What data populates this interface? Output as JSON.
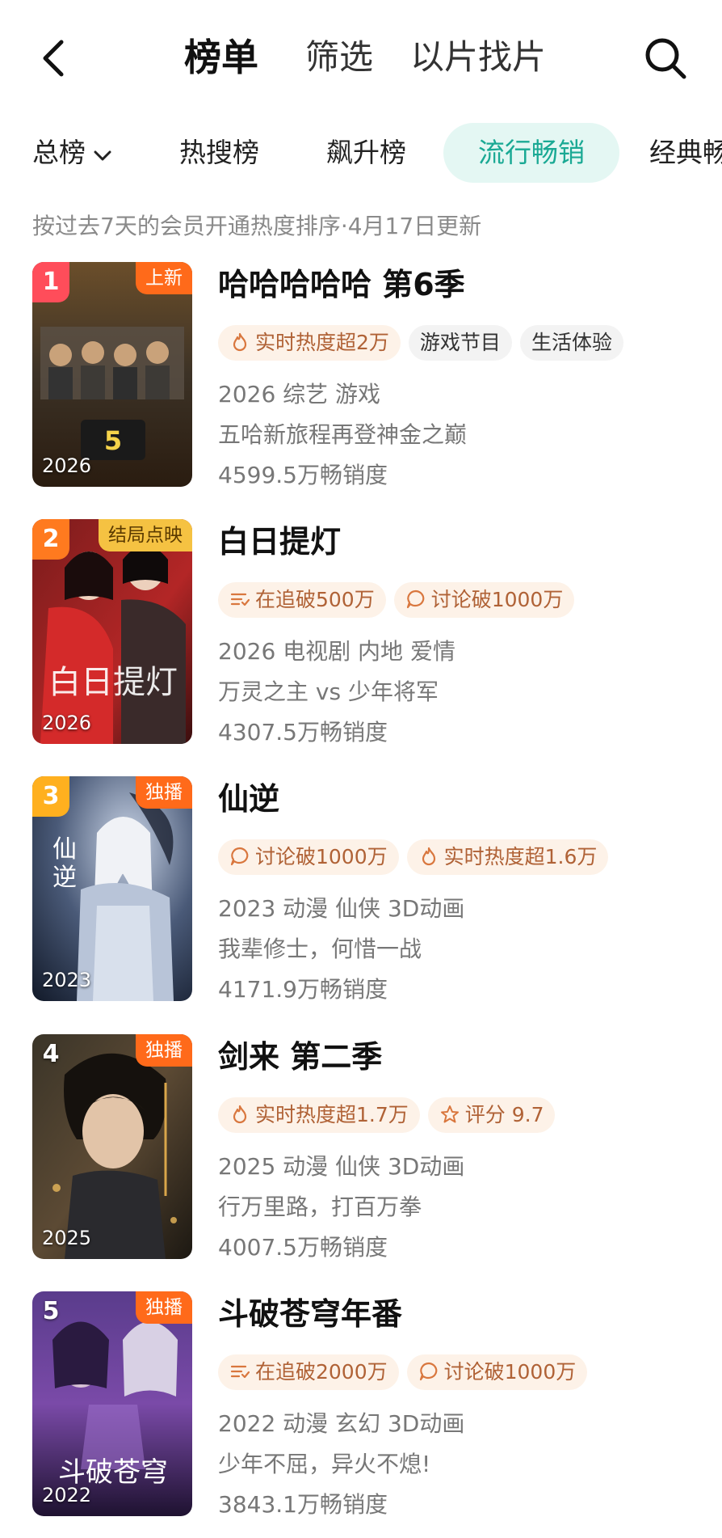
{
  "header": {
    "title": "榜单",
    "filter_label": "筛选",
    "photo_search_label": "以片找片"
  },
  "tabs": {
    "total": "总榜",
    "hot_search": "热搜榜",
    "rising": "飙升榜",
    "popular": "流行畅销",
    "classic": "经典畅"
  },
  "subtitle": "按过去7天的会员开通热度排序·4月17日更新",
  "items": [
    {
      "rank": "1",
      "corner_tag": "上新",
      "year_label": "2026",
      "title": "哈哈哈哈哈 第6季",
      "chips": [
        {
          "icon": "flame-icon",
          "text": "实时热度超2万"
        },
        {
          "icon": "",
          "text": "游戏节目"
        },
        {
          "icon": "",
          "text": "生活体验"
        }
      ],
      "meta": "2026 综艺 游戏",
      "tagline": "五哈新旅程再登神金之巅",
      "sales": "4599.5万畅销度"
    },
    {
      "rank": "2",
      "corner_tag": "结局点映",
      "year_label": "2026",
      "title": "白日提灯",
      "chips": [
        {
          "icon": "list-icon",
          "text": "在追破500万"
        },
        {
          "icon": "comment-icon",
          "text": "讨论破1000万"
        }
      ],
      "meta": "2026 电视剧 内地 爱情",
      "tagline": "万灵之主 vs 少年将军",
      "sales": "4307.5万畅销度"
    },
    {
      "rank": "3",
      "corner_tag": "独播",
      "year_label": "2023",
      "title": "仙逆",
      "chips": [
        {
          "icon": "comment-icon",
          "text": "讨论破1000万"
        },
        {
          "icon": "flame-icon",
          "text": "实时热度超1.6万"
        }
      ],
      "meta": "2023 动漫 仙侠 3D动画",
      "tagline": "我辈修士，何惜一战",
      "sales": "4171.9万畅销度"
    },
    {
      "rank": "4",
      "corner_tag": "独播",
      "year_label": "2025",
      "title": "剑来 第二季",
      "chips": [
        {
          "icon": "flame-icon",
          "text": "实时热度超1.7万"
        },
        {
          "icon": "star-icon",
          "text": "评分 9.7"
        }
      ],
      "meta": "2025 动漫 仙侠 3D动画",
      "tagline": "行万里路，打百万拳",
      "sales": "4007.5万畅销度"
    },
    {
      "rank": "5",
      "corner_tag": "独播",
      "year_label": "2022",
      "title": "斗破苍穹年番",
      "chips": [
        {
          "icon": "list-icon",
          "text": "在追破2000万"
        },
        {
          "icon": "comment-icon",
          "text": "讨论破1000万"
        }
      ],
      "meta": "2022 动漫 玄幻 3D动画",
      "tagline": "少年不屈，异火不熄!",
      "sales": "3843.1万畅销度"
    }
  ],
  "colors": {
    "accent_teal": "#1aa994",
    "tab_active_bg": "#e4f7f3",
    "rank1": "#ff4d5a",
    "rank2": "#ff7a1f",
    "rank3": "#ffb01f",
    "corner_orange": "#ff6a1a",
    "corner_gold": "#f5c242",
    "chip_warm_bg": "#fdf2e8",
    "chip_warm_text": "#b06236"
  }
}
